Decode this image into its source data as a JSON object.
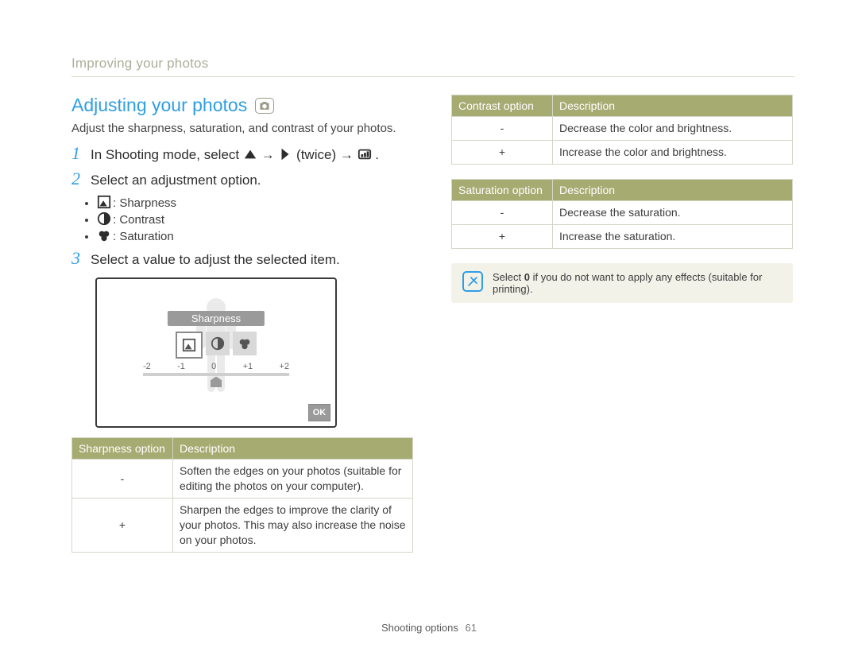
{
  "breadcrumb": "Improving your photos",
  "title": "Adjusting your photos",
  "intro": "Adjust the sharpness, saturation, and contrast of your photos.",
  "steps": {
    "s1_a": "In Shooting mode, select ",
    "s1_b": " → ",
    "s1_c": " (twice) → ",
    "s1_d": ".",
    "s2": "Select an adjustment option.",
    "s3": "Select a value to adjust the selected item."
  },
  "bullets": {
    "sharp": ": Sharpness",
    "contrast": ": Contrast",
    "saturation": ": Saturation"
  },
  "lcd": {
    "label": "Sharpness",
    "ticks": [
      "-2",
      "-1",
      "0",
      "+1",
      "+2"
    ],
    "ok": "OK"
  },
  "tables": {
    "sharp": {
      "h1": "Sharpness option",
      "h2": "Description",
      "rows": [
        {
          "opt": "-",
          "desc": "Soften the edges on your photos (suitable for editing the photos on your computer)."
        },
        {
          "opt": "+",
          "desc": "Sharpen the edges to improve the clarity of your photos. This may also increase the noise on your photos."
        }
      ]
    },
    "contrast": {
      "h1": "Contrast option",
      "h2": "Description",
      "rows": [
        {
          "opt": "-",
          "desc": "Decrease the color and brightness."
        },
        {
          "opt": "+",
          "desc": "Increase the color and brightness."
        }
      ]
    },
    "saturation": {
      "h1": "Saturation option",
      "h2": "Description",
      "rows": [
        {
          "opt": "-",
          "desc": "Decrease the saturation."
        },
        {
          "opt": "+",
          "desc": "Increase the saturation."
        }
      ]
    }
  },
  "note_a": "Select ",
  "note_b": "0",
  "note_c": " if you do not want to apply any effects (suitable for printing).",
  "footer_section": "Shooting options",
  "footer_page": "61"
}
